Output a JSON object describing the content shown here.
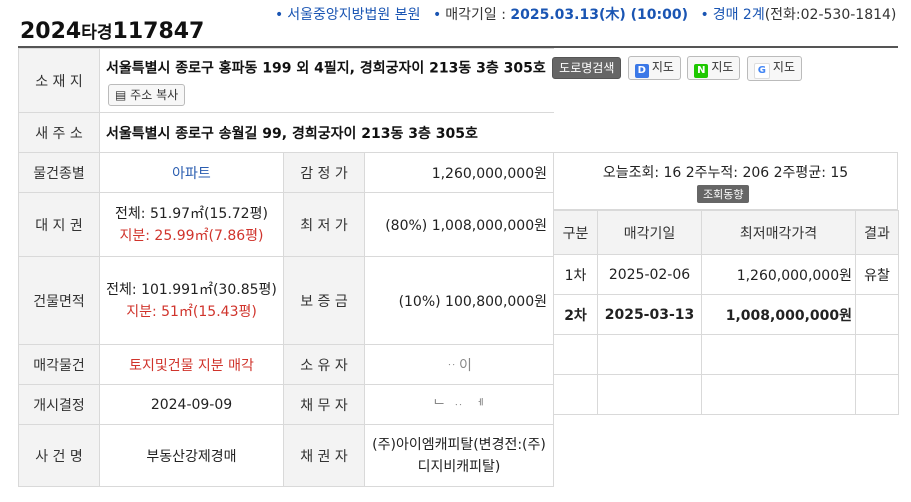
{
  "case": {
    "year": "2024",
    "kind": "타경",
    "number": "117847"
  },
  "header": {
    "court": "서울중앙지방법원 본원",
    "sale_date_label": "매각기일 :",
    "sale_date": "2025.03.13(木) (10:00)",
    "dept": "경매 2계",
    "phone": "(전화:02-530-1814)"
  },
  "location": {
    "label": "소 재 지",
    "address": "서울특별시 종로구 홍파동 199 외 4필지, 경희궁자이 213동 3층 305호",
    "road_search_btn": "도로명검색",
    "map_d_btn": "지도",
    "map_n_btn": "지도",
    "map_g_btn": "지도",
    "copy_btn": "주소 복사"
  },
  "new_address": {
    "label": "새 주 소",
    "value": "서울특별시 종로구 송월길 99, 경희궁자이 213동 3층 305호"
  },
  "rows": {
    "type_label": "물건종별",
    "type_value": "아파트",
    "appraisal_label": "감 정 가",
    "appraisal_value": "1,260,000,000원",
    "land_label": "대 지 권",
    "land_total": "전체: 51.97㎡(15.72평)",
    "land_share": "지분: 25.99㎡(7.86평)",
    "min_label": "최 저 가",
    "min_value": "(80%) 1,008,000,000원",
    "building_label": "건물면적",
    "building_total": "전체: 101.991㎡(30.85평)",
    "building_share": "지분: 51㎡(15.43평)",
    "deposit_label": "보 증 금",
    "deposit_value": "(10%) 100,800,000원",
    "sale_item_label": "매각물건",
    "sale_item_value": "토지및건물 지분 매각",
    "owner_label": "소 유 자",
    "owner_value": "ᆢ이",
    "start_label": "개시결정",
    "start_value": "2024-09-09",
    "debtor_label": "채 무 자",
    "debtor_value": "ᄂ ᆢ ᅦ",
    "case_name_label": "사 건 명",
    "case_name_value": "부동산강제경매",
    "creditor_label": "채 권 자",
    "creditor_value": "(주)아이엠캐피탈(변경전:(주)디지비캐피탈)"
  },
  "stats": {
    "text": "오늘조회: 16  2주누적: 206  2주평균: 15",
    "trend_btn": "조회동향"
  },
  "history": {
    "headers": [
      "구분",
      "매각기일",
      "최저매각가격",
      "결과"
    ],
    "rows": [
      [
        "1차",
        "2025-02-06",
        "1,260,000,000원",
        "유찰"
      ],
      [
        "2차",
        "2025-03-13",
        "1,008,000,000원",
        ""
      ]
    ]
  },
  "colors": {
    "blue": "#1a55b3",
    "red": "#d0342c",
    "label_bg": "#f3f3f3",
    "border": "#d9d9d9"
  }
}
